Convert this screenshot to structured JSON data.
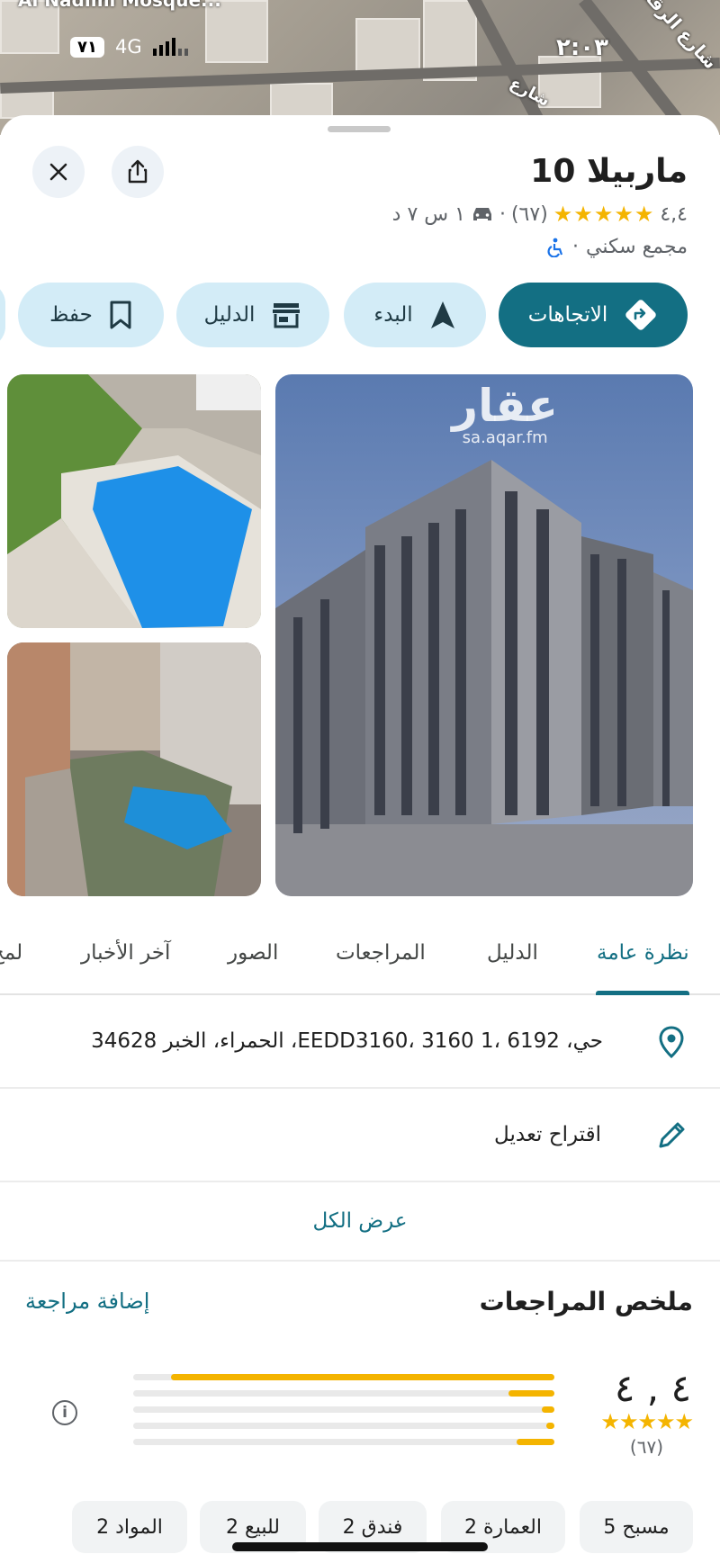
{
  "map": {
    "label_top_left": "Al Nadimi Mosque...",
    "road_label": "شارع الرقه",
    "road_label_2": "شارع"
  },
  "status_bar": {
    "sim": "٧١",
    "network": "4G",
    "time": "٢:٠٣"
  },
  "place": {
    "title": "ماربيلا 10",
    "rating": "٤,٤",
    "stars": "★★★★★",
    "review_count": "(٦٧)",
    "drive_time": "١ س ٧ د",
    "category": "مجمع سكني"
  },
  "actions": {
    "directions": "الاتجاهات",
    "start": "البدء",
    "directory": "الدليل",
    "save": "حفظ"
  },
  "photos": {
    "watermark_ar": "عقار",
    "watermark_url": "sa.aqar.fm"
  },
  "tabs": [
    {
      "label": "نظرة عامة",
      "active": true
    },
    {
      "label": "الدليل"
    },
    {
      "label": "المراجعات"
    },
    {
      "label": "الصور"
    },
    {
      "label": "آخر الأخبار"
    },
    {
      "label": "لمح"
    }
  ],
  "details": {
    "address": "حي، 6192 ،1 3160 ،EEDD3160، الحمراء، الخبر 34628",
    "suggest_edit": "اقتراح تعديل",
    "see_all": "عرض الكل"
  },
  "reviews": {
    "title": "ملخص المراجعات",
    "add_review": "إضافة مراجعة",
    "rating": "٤ , ٤",
    "stars": "★★★★★",
    "count": "(٦٧)",
    "distribution": [
      {
        "stars": 5,
        "fraction": 0.91
      },
      {
        "stars": 4,
        "fraction": 0.11
      },
      {
        "stars": 3,
        "fraction": 0.03
      },
      {
        "stars": 2,
        "fraction": 0.02
      },
      {
        "stars": 1,
        "fraction": 0.09
      }
    ]
  },
  "chips": [
    "مسبح 5",
    "العمارة 2",
    "فندق 2",
    "للبيع 2",
    "المواد 2"
  ],
  "colors": {
    "accent": "#136f83",
    "pill_bg": "#d3ecf7",
    "star": "#f4b400"
  }
}
